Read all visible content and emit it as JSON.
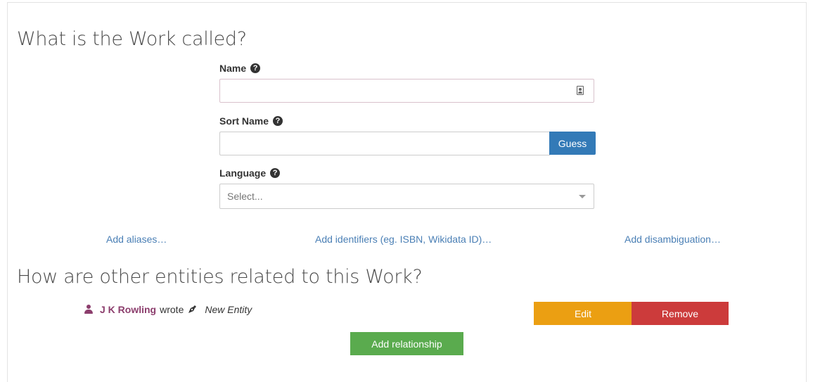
{
  "section_name": {
    "heading": "What is the Work called?",
    "name_label": "Name",
    "name_value": "",
    "sort_name_label": "Sort Name",
    "sort_name_value": "",
    "guess_label": "Guess",
    "language_label": "Language",
    "language_placeholder": "Select...",
    "help_icon": "question-circle-icon",
    "links": {
      "aliases": "Add aliases…",
      "identifiers": "Add identifiers (eg. ISBN, Wikidata ID)…",
      "disambiguation": "Add disambiguation…"
    }
  },
  "section_relationships": {
    "heading": "How are other entities related to this Work?",
    "relationship": {
      "author": "J K Rowling",
      "verb": "wrote",
      "target": "New Entity"
    },
    "edit_label": "Edit",
    "remove_label": "Remove",
    "add_label": "Add relationship"
  },
  "colors": {
    "primary": "#337ab7",
    "warning": "#eb9f12",
    "danger": "#cc3b3b",
    "success": "#5aab4e",
    "entity": "#8c3e6d"
  }
}
